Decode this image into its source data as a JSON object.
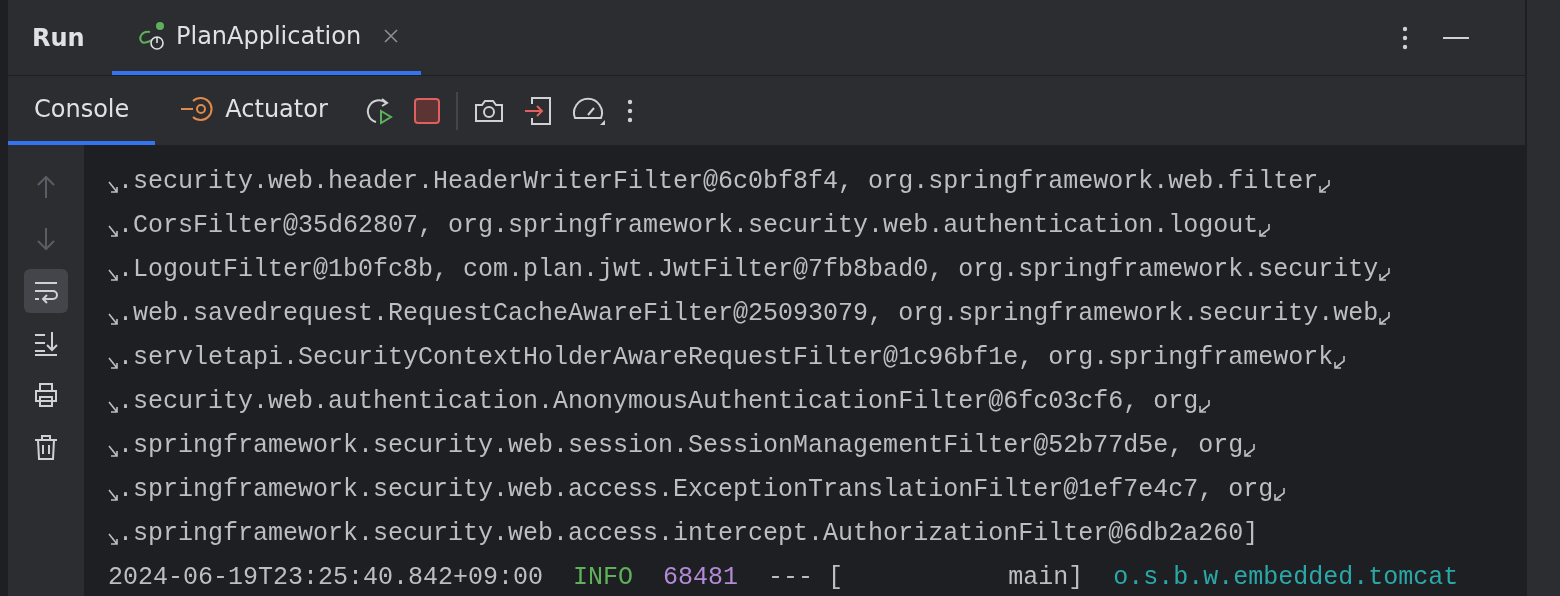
{
  "panel": {
    "title": "Run"
  },
  "run_tabs": [
    {
      "label": "PlanApplication",
      "selected": true
    }
  ],
  "console_tabs": [
    {
      "label": "Console",
      "kind": "console",
      "selected": true
    },
    {
      "label": "Actuator",
      "kind": "actuator",
      "selected": false
    }
  ],
  "toolbar": [
    {
      "kind": "rerun"
    },
    {
      "kind": "stop"
    },
    {
      "kind": "separator"
    },
    {
      "kind": "camera"
    },
    {
      "kind": "exit"
    },
    {
      "kind": "gauge"
    },
    {
      "kind": "more"
    }
  ],
  "gutter": [
    {
      "kind": "up",
      "disabled": true,
      "selected": false
    },
    {
      "kind": "down",
      "disabled": true,
      "selected": false
    },
    {
      "kind": "wrap",
      "disabled": false,
      "selected": true
    },
    {
      "kind": "scroll-end",
      "disabled": false,
      "selected": false
    },
    {
      "kind": "print",
      "disabled": false,
      "selected": false
    },
    {
      "kind": "trash",
      "disabled": false,
      "selected": false
    }
  ],
  "lines": [
    {
      "wrapped": true,
      "segments": [
        {
          "kind": "plain",
          "text": ".security.web.header.HeaderWriterFilter@6c0bf8f4, org.springframework.web.filter"
        }
      ]
    },
    {
      "wrapped": true,
      "segments": [
        {
          "kind": "plain",
          "text": ".CorsFilter@35d62807, org.springframework.security.web.authentication.logout"
        }
      ]
    },
    {
      "wrapped": true,
      "segments": [
        {
          "kind": "plain",
          "text": ".LogoutFilter@1b0fc8b, com.plan.jwt.JwtFilter@7fb8bad0, org.springframework.security"
        }
      ]
    },
    {
      "wrapped": true,
      "segments": [
        {
          "kind": "plain",
          "text": ".web.savedrequest.RequestCacheAwareFilter@25093079, org.springframework.security.web"
        }
      ]
    },
    {
      "wrapped": true,
      "segments": [
        {
          "kind": "plain",
          "text": ".servletapi.SecurityContextHolderAwareRequestFilter@1c96bf1e, org.springframework"
        }
      ]
    },
    {
      "wrapped": true,
      "segments": [
        {
          "kind": "plain",
          "text": ".security.web.authentication.AnonymousAuthenticationFilter@6fc03cf6, org"
        }
      ]
    },
    {
      "wrapped": true,
      "segments": [
        {
          "kind": "plain",
          "text": ".springframework.security.web.session.SessionManagementFilter@52b77d5e, org"
        }
      ]
    },
    {
      "wrapped": true,
      "segments": [
        {
          "kind": "plain",
          "text": ".springframework.security.web.access.ExceptionTranslationFilter@1ef7e4c7, org"
        }
      ]
    },
    {
      "wrapped": false,
      "segments": [
        {
          "kind": "plain",
          "text": ".springframework.security.web.access.intercept.AuthorizationFilter@6db2a260]"
        }
      ]
    },
    {
      "wrapped": false,
      "continuation": false,
      "segments": [
        {
          "kind": "plain",
          "text": "2024-06-19T23:25:40.842+09:00"
        },
        {
          "kind": "level",
          "text": "INFO"
        },
        {
          "kind": "pid",
          "text": "68481"
        },
        {
          "kind": "plain",
          "text": "--- [           main]"
        },
        {
          "kind": "logger",
          "text": "o.s.b.w.embedded.tomcat"
        }
      ]
    }
  ]
}
